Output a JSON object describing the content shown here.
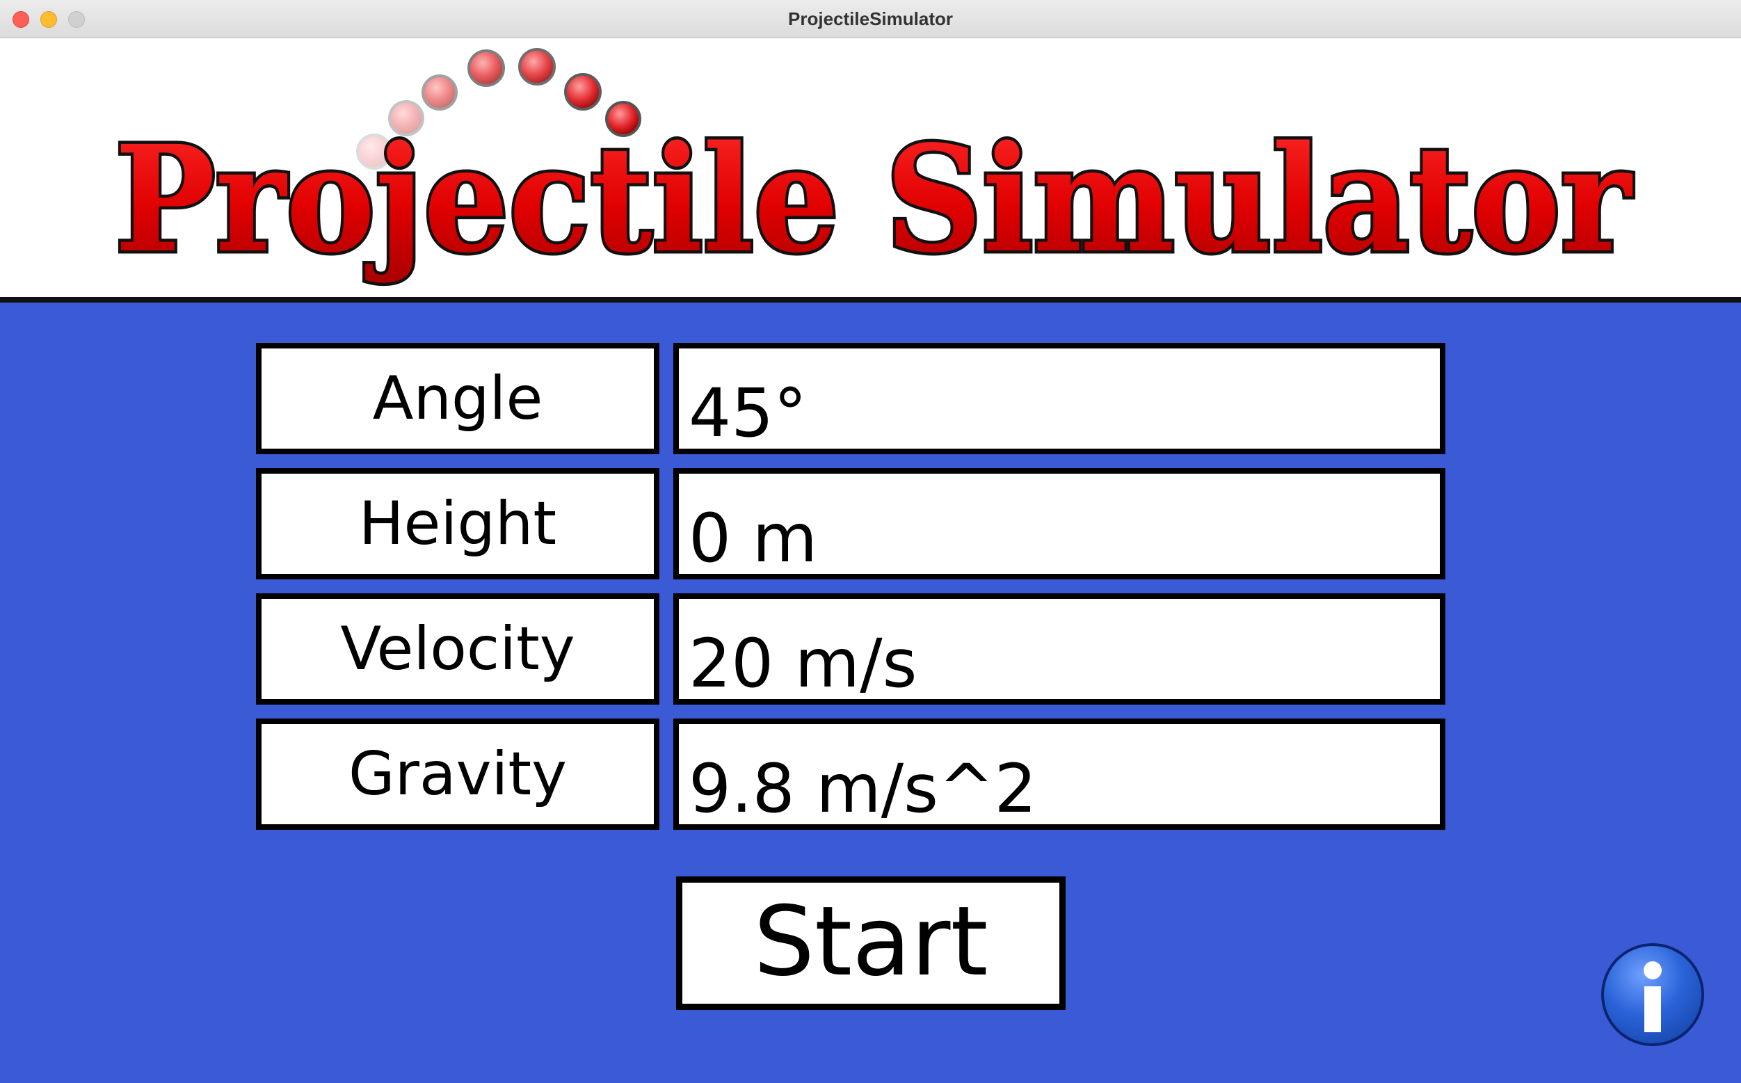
{
  "window": {
    "title": "ProjectileSimulator"
  },
  "banner": {
    "logo_text": "Projectile Simulator"
  },
  "form": {
    "rows": [
      {
        "label": "Angle",
        "value": "45°"
      },
      {
        "label": "Height",
        "value": "0 m"
      },
      {
        "label": "Velocity",
        "value": "20 m/s"
      },
      {
        "label": "Gravity",
        "value": "9.8 m/s^2"
      }
    ]
  },
  "actions": {
    "start_label": "Start",
    "info_icon": "info-icon"
  },
  "colors": {
    "background": "#3b5bd6",
    "logo_red": "#e00000",
    "projectile_red": "#e3262b"
  }
}
